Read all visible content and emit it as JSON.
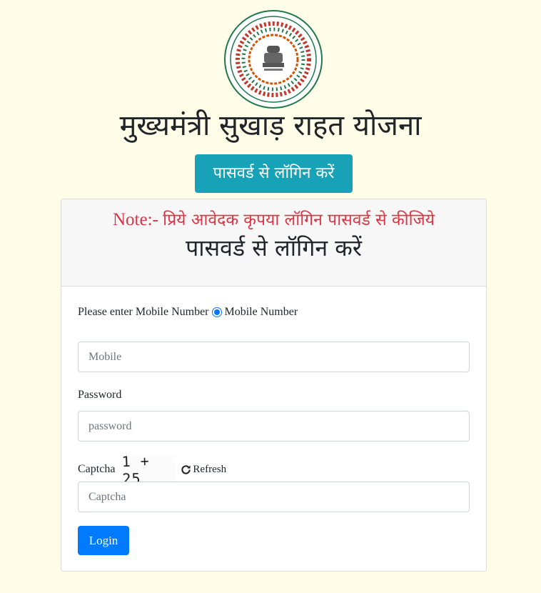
{
  "header": {
    "page_title": "मुख्यमंत्री सुखाड़ राहत योजना",
    "login_tab_label": "पासवर्ड से लॉगिन करें"
  },
  "card": {
    "note_prefix": "Note:-",
    "note_text": "प्रिये आवेदक कृपया लॉगिन पासवर्ड से कीजिये",
    "title": "पासवर्ड से लॉगिन करें"
  },
  "form": {
    "mobile_prompt": "Please enter Mobile Number",
    "mobile_radio_label": "Mobile Number",
    "mobile_placeholder": "Mobile",
    "password_label": "Password",
    "password_placeholder": "password",
    "captcha_label": "Captcha",
    "captcha_question": "1 + 25",
    "refresh_label": "Refresh",
    "captcha_placeholder": "Captcha",
    "login_label": "Login"
  },
  "colors": {
    "background": "#fffde8",
    "teal_button": "#17a2b8",
    "note_red": "#dc3545",
    "primary_blue": "#007bff"
  },
  "icons": {
    "emblem": "jharkhand-government-emblem",
    "refresh": "refresh-icon"
  }
}
